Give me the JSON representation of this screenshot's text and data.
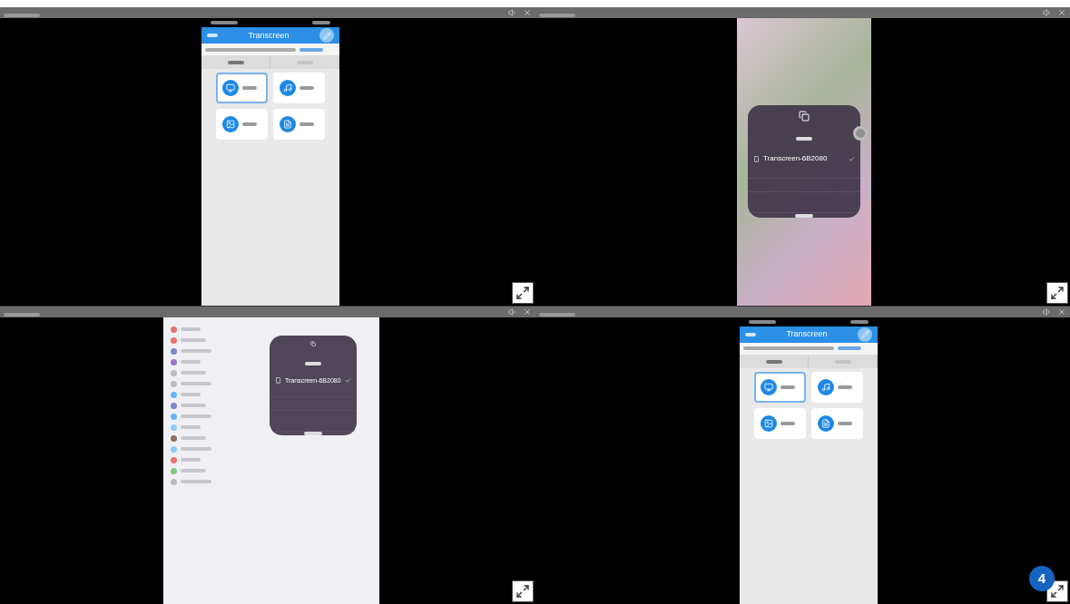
{
  "panels": [
    {
      "kind": "phone-app",
      "title": "Transcreen",
      "tabs": [
        {
          "selected": true
        },
        {
          "selected": false
        }
      ],
      "tiles": [
        {
          "selected": true
        },
        {
          "selected": false
        },
        {
          "selected": false
        },
        {
          "selected": false
        }
      ]
    },
    {
      "kind": "phone-dialog",
      "device": "Transcreen-6B2080",
      "checked": true
    },
    {
      "kind": "tablet-dialog",
      "device": "Transcreen-6B2080",
      "checked": true
    },
    {
      "kind": "phone-app",
      "title": "Transcreen",
      "tabs": [
        {
          "selected": true
        },
        {
          "selected": false
        }
      ],
      "tiles": [
        {
          "selected": true
        },
        {
          "selected": false
        },
        {
          "selected": false
        },
        {
          "selected": false
        }
      ]
    }
  ],
  "badge": "4"
}
